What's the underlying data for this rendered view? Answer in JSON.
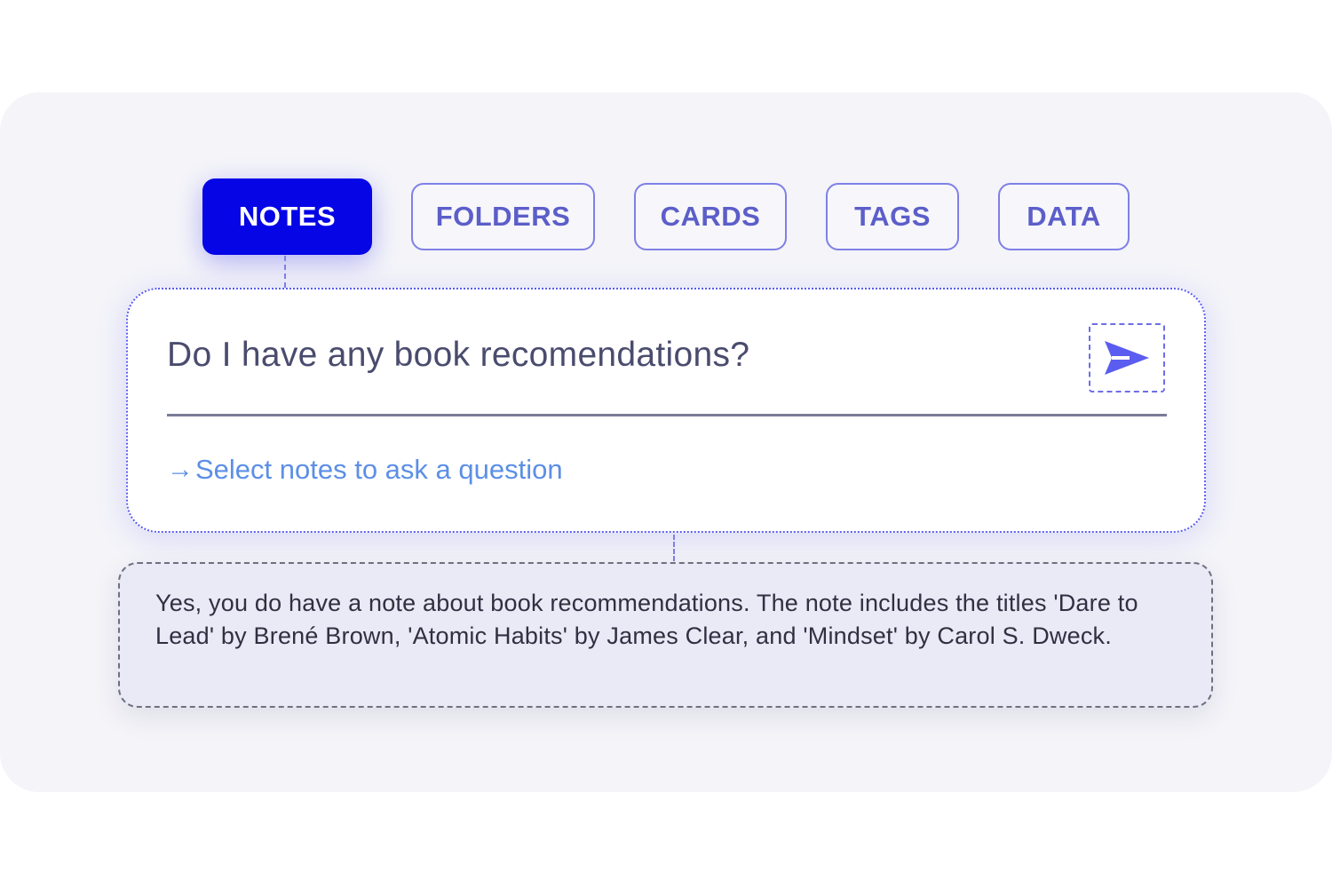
{
  "tabs": [
    {
      "label": "NOTES",
      "active": true
    },
    {
      "label": "FOLDERS",
      "active": false
    },
    {
      "label": "CARDS",
      "active": false
    },
    {
      "label": "TAGS",
      "active": false
    },
    {
      "label": "DATA",
      "active": false
    }
  ],
  "query": {
    "text": "Do I have any book recomendations?",
    "send_icon": "send-icon"
  },
  "hint": {
    "arrow": "→",
    "text": "Select notes to ask a question"
  },
  "answer": {
    "text": "Yes, you do have a note about book recommendations. The note includes the titles 'Dare to Lead' by Brené Brown, 'Atomic Habits' by James Clear, and 'Mindset' by Carol S. Dweck."
  },
  "colors": {
    "accent": "#0505e6",
    "tab_border": "#7f80e6",
    "hint": "#5c8fe6",
    "background": "#f4f4f9"
  }
}
